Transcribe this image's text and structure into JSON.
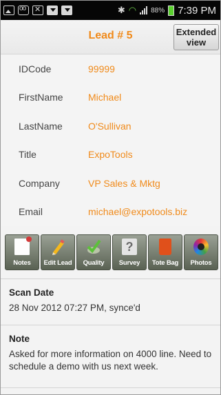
{
  "status_bar": {
    "battery_percent": "88%",
    "time": "7:39 PM",
    "icons": [
      "image-icon",
      "voicemail-icon",
      "mail-icon",
      "download-icon",
      "download-icon",
      "bluetooth-icon",
      "wifi-icon",
      "signal-icon",
      "battery-icon"
    ]
  },
  "header": {
    "title": "Lead # 5",
    "extended_view_button": "Extended view"
  },
  "fields": [
    {
      "label": "IDCode",
      "value": "99999"
    },
    {
      "label": "FirstName",
      "value": "Michael"
    },
    {
      "label": "LastName",
      "value": "O'Sullivan"
    },
    {
      "label": "Title",
      "value": "ExpoTools"
    },
    {
      "label": "Company",
      "value": "VP Sales & Mktg"
    },
    {
      "label": "Email",
      "value": "michael@expotools.biz"
    }
  ],
  "toolbar": [
    {
      "label": "Notes",
      "icon": "notes-icon"
    },
    {
      "label": "Edit Lead",
      "icon": "pencil-icon"
    },
    {
      "label": "Quality",
      "icon": "checkmark-icon"
    },
    {
      "label": "Survey",
      "icon": "question-icon"
    },
    {
      "label": "Tote Bag",
      "icon": "tote-bag-icon"
    },
    {
      "label": "Photos",
      "icon": "camera-icon"
    }
  ],
  "scan": {
    "title": "Scan Date",
    "value": "28 Nov 2012 07:27 PM, synce'd"
  },
  "note": {
    "title": "Note",
    "text": "Asked for more information on 4000 line. Need to schedule a demo with us next week."
  },
  "colors": {
    "accent": "#f08a1a",
    "toolbar_button": "#6f7768",
    "status_bar": "#060606"
  }
}
